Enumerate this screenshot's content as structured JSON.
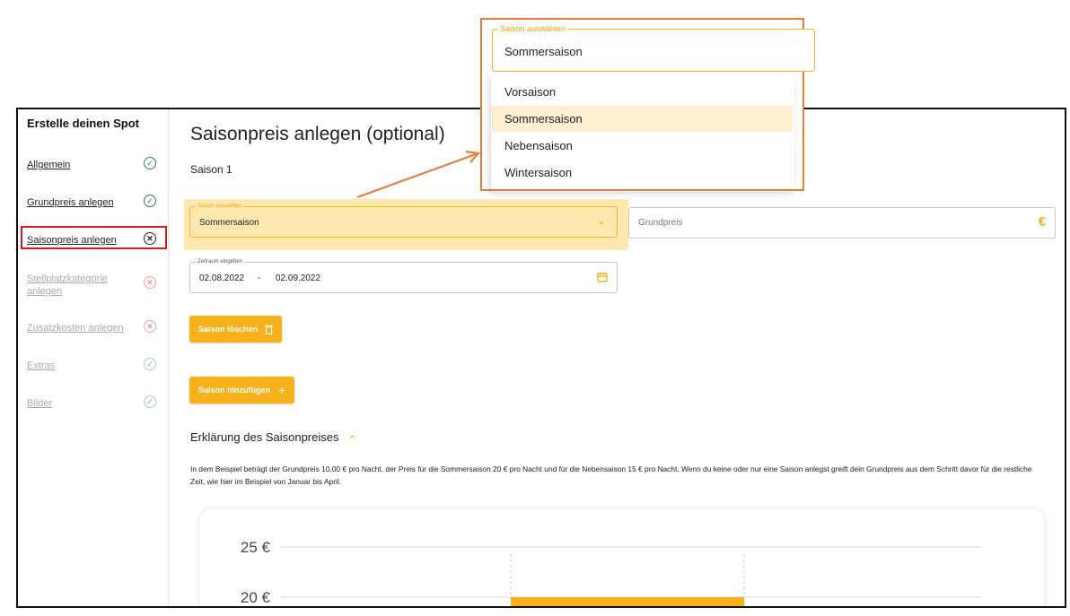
{
  "sidebar": {
    "title": "Erstelle deinen Spot",
    "items": [
      {
        "label": "Allgemein"
      },
      {
        "label": "Grundpreis anlegen"
      },
      {
        "label": "Saisonpreis anlegen"
      },
      {
        "label_line1": "Stellplatzkategorie",
        "label_line2": "anlegen"
      },
      {
        "label": "Zusatzkosten anlegen"
      },
      {
        "label": "Extras"
      },
      {
        "label": "Bilder"
      }
    ]
  },
  "main": {
    "title": "Saisonpreis anlegen (optional)",
    "season_heading": "Saison 1",
    "season_select": {
      "legend": "Saison auswählen",
      "value": "Sommersaison"
    },
    "base_price": {
      "placeholder": "Grundpreis",
      "currency": "€"
    },
    "date_range": {
      "legend": "Zeitraum eingeben",
      "start": "02.08.2022",
      "separator": "-",
      "end": "02.09.2022"
    },
    "delete_button": "Saison löschen",
    "add_button": "Saison hinzufügen",
    "add_icon": "+",
    "explanation_heading": "Erklärung des Saisonpreises",
    "explanation_text": "In dem Beispiel beträgt der Grundpreis 10,00 € pro Nacht, der Preis für die Sommersaison 20 € pro Nacht und für die Nebensaison 15 € pro Nacht. Wenn du keine oder nur eine Saison anlegst greift dein Grundpreis aus dem Schritt davor für die restliche Zeit, wie hier im Beispiel von Januar bis April."
  },
  "callout": {
    "legend": "Saison auswählen",
    "value": "Sommersaison",
    "options": [
      "Vorsaison",
      "Sommersaison",
      "Nebensaison",
      "Wintersaison"
    ],
    "selected": "Sommersaison"
  },
  "chart_data": {
    "type": "bar",
    "tick_labels": [
      "25 €",
      "20 €"
    ],
    "visible_ticks": [
      25,
      20
    ],
    "values": [
      20
    ],
    "bar_color": "#f7b21b"
  },
  "colors": {
    "accent": "#f7b21b",
    "highlight": "#fde9b0",
    "callout": "#e67e3a",
    "error": "#d71920",
    "success": "#2e7d5b"
  },
  "icons": {
    "check": "✓",
    "cross": "✕",
    "chevron_down": "⌄",
    "chevron_up": "⌃"
  }
}
